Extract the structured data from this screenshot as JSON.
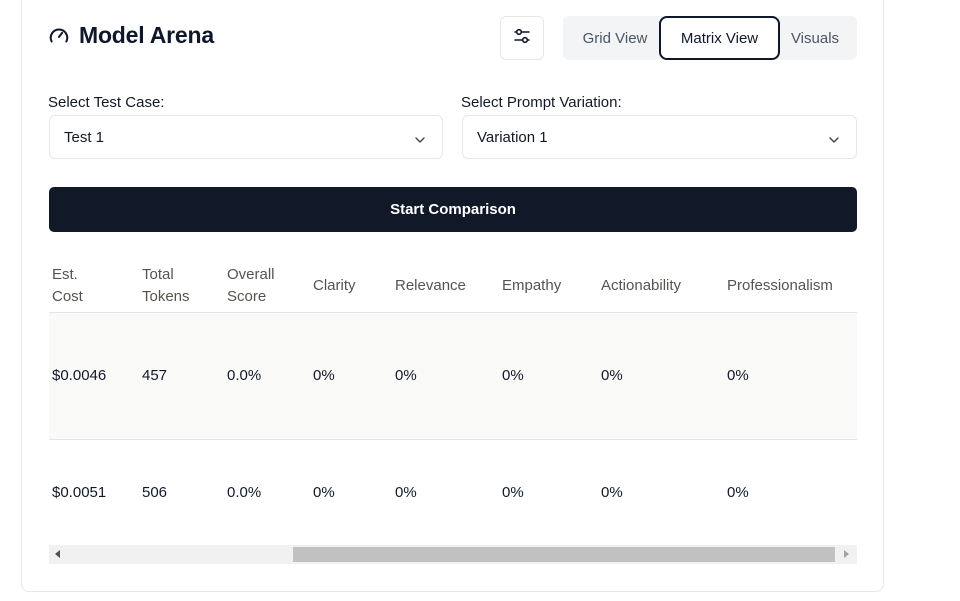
{
  "header": {
    "title": "Model Arena",
    "title_icon": "gauge-icon",
    "filter_icon": "sliders-icon"
  },
  "view_tabs": [
    {
      "label": "Grid View",
      "active": false
    },
    {
      "label": "Matrix View",
      "active": true
    },
    {
      "label": "Visuals",
      "active": false
    }
  ],
  "test_case": {
    "label": "Select Test Case:",
    "value": "Test 1"
  },
  "prompt_variation": {
    "label": "Select Prompt Variation:",
    "value": "Variation 1"
  },
  "start_button": {
    "label": "Start Comparison"
  },
  "table": {
    "headers": [
      [
        "Est.",
        "Cost"
      ],
      [
        "Total",
        "Tokens"
      ],
      [
        "Overall",
        "Score"
      ],
      [
        "Clarity"
      ],
      [
        "Relevance"
      ],
      [
        "Empathy"
      ],
      [
        "Actionability"
      ],
      [
        "Professionalism"
      ]
    ],
    "rows": [
      [
        "$0.0046",
        "457",
        "0.0%",
        "0%",
        "0%",
        "0%",
        "0%",
        "0%"
      ],
      [
        "$0.0051",
        "506",
        "0.0%",
        "0%",
        "0%",
        "0%",
        "0%",
        "0%"
      ]
    ]
  },
  "colors": {
    "primary": "#111827",
    "header_text": "#57534e",
    "row_highlight": "#f9f9f8"
  }
}
